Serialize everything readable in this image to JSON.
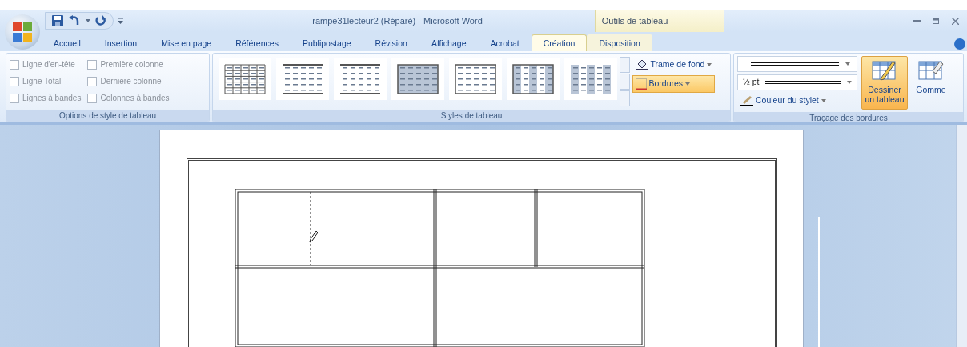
{
  "window": {
    "title": "rampe31lecteur2 (Réparé) - Microsoft Word",
    "context_group": "Outils de tableau"
  },
  "tabs": [
    {
      "label": "Accueil",
      "selected": false,
      "contextual": false
    },
    {
      "label": "Insertion",
      "selected": false,
      "contextual": false
    },
    {
      "label": "Mise en page",
      "selected": false,
      "contextual": false
    },
    {
      "label": "Références",
      "selected": false,
      "contextual": false
    },
    {
      "label": "Publipostage",
      "selected": false,
      "contextual": false
    },
    {
      "label": "Révision",
      "selected": false,
      "contextual": false
    },
    {
      "label": "Affichage",
      "selected": false,
      "contextual": false
    },
    {
      "label": "Acrobat",
      "selected": false,
      "contextual": false
    },
    {
      "label": "Création",
      "selected": true,
      "contextual": true
    },
    {
      "label": "Disposition",
      "selected": false,
      "contextual": true
    }
  ],
  "style_options": {
    "label": "Options de style de tableau",
    "options": [
      {
        "label": "Ligne d'en-tête",
        "checked": false
      },
      {
        "label": "Ligne Total",
        "checked": false
      },
      {
        "label": "Lignes à bandes",
        "checked": false
      },
      {
        "label": "Première colonne",
        "checked": false
      },
      {
        "label": "Dernière colonne",
        "checked": false
      },
      {
        "label": "Colonnes à bandes",
        "checked": false
      }
    ]
  },
  "table_styles": {
    "label": "Styles de tableau",
    "styles": [
      {
        "kind": "grid"
      },
      {
        "kind": "lines"
      },
      {
        "kind": "lines"
      },
      {
        "kind": "shaded"
      },
      {
        "kind": "boxed"
      },
      {
        "kind": "banded"
      },
      {
        "kind": "striped"
      }
    ],
    "buttons": [
      {
        "label": "Trame de fond",
        "kind": "shading",
        "selected": false
      },
      {
        "label": "Bordures",
        "kind": "borders",
        "selected": true
      }
    ]
  },
  "border_drawing": {
    "label": "Traçage des bordures",
    "line_weight": "½ pt",
    "pen_color": "Couleur du stylet",
    "tools": [
      {
        "label": "Dessiner un tableau",
        "kind": "draw",
        "selected": true
      },
      {
        "label": "Gomme",
        "kind": "eraser",
        "selected": false
      }
    ]
  }
}
